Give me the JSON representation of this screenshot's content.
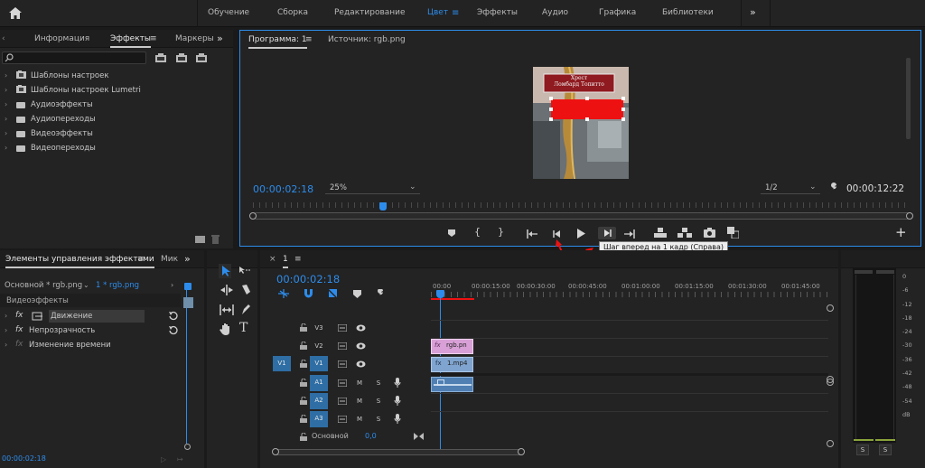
{
  "workspaces": [
    "Обучение",
    "Сборка",
    "Редактирование",
    "Цвет",
    "Эффекты",
    "Аудио",
    "Графика",
    "Библиотеки"
  ],
  "workspaces_more": "»",
  "active_workspace": "Цвет",
  "left_panel": {
    "tabs": [
      "Информация",
      "Эффекты",
      "Маркеры"
    ],
    "more": "»",
    "items": [
      "Шаблоны настроек",
      "Шаблоны настроек Lumetri",
      "Аудиоэффекты",
      "Аудиопереходы",
      "Видеоэффекты",
      "Видеопереходы"
    ]
  },
  "effect_controls": {
    "tab": "Элементы управления эффектами",
    "tab2": "Мик",
    "more": "»",
    "master": "Основной * rgb.png",
    "clip": "1 * rgb.png",
    "section": "Видеоэффекты",
    "effects": [
      "Движение",
      "Непрозрачность",
      "Изменение времени"
    ],
    "timecode": "00:00:02:18"
  },
  "program_monitor": {
    "tab": "Программа: 1",
    "source_tab": "Источник: rgb.png",
    "timecode": "00:00:02:18",
    "zoom": "25%",
    "resolution": "1/2",
    "duration": "00:00:12:22",
    "overlay_title": "Хрест",
    "overlay_subtitle": "Ломбард Топитто",
    "tooltip": "Шаг вперед на 1 кадр (Справа)",
    "add": "+"
  },
  "timeline": {
    "tab": "1",
    "close": "×",
    "timecode": "00:00:02:18",
    "ruler": [
      "00:00",
      "00:00:15:00",
      "00:00:30:00",
      "00:00:45:00",
      "00:01:00:00",
      "00:01:15:00",
      "00:01:30:00",
      "00:01:45:00"
    ],
    "tracks": [
      {
        "name": "V3",
        "source": ""
      },
      {
        "name": "V2",
        "source": ""
      },
      {
        "name": "V1",
        "source": "V1"
      },
      {
        "name": "A1",
        "source": ""
      },
      {
        "name": "A2",
        "source": ""
      },
      {
        "name": "A3",
        "source": ""
      }
    ],
    "master_label": "Основной",
    "master_value": "0,0",
    "clips": {
      "v2": "rgb.pn",
      "v1": "1.mp4"
    },
    "mute": "M",
    "solo": "S"
  },
  "meter": {
    "scale": [
      "0",
      "-6",
      "-12",
      "-18",
      "-24",
      "-30",
      "-36",
      "-42",
      "-48",
      "-54",
      "dB"
    ],
    "solo_left": "S",
    "solo_right": "S"
  },
  "colors": {
    "accent": "#2d8ceb",
    "red": "#ee1111",
    "clip_pink": "#d8a0d6",
    "clip_blue": "#7fa4cf"
  }
}
